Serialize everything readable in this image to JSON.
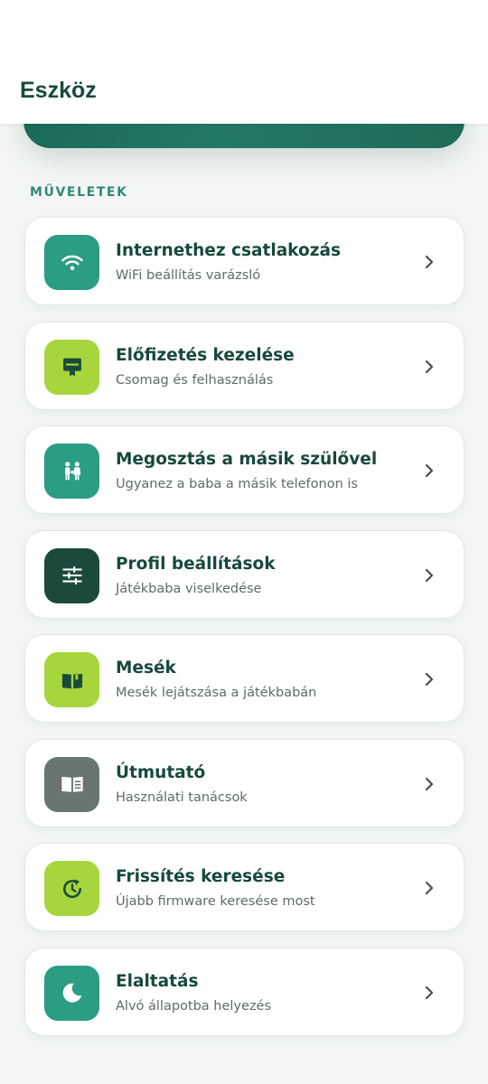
{
  "header": {
    "title": "Eszköz"
  },
  "section": {
    "label": "MŰVELETEK"
  },
  "items": [
    {
      "title": "Internethez csatlakozás",
      "subtitle": "WiFi beállítás varázsló",
      "icon": "wifi-icon",
      "color": "#2a9d84"
    },
    {
      "title": "Előfizetés kezelése",
      "subtitle": "Csomag és felhasználás",
      "icon": "subscription-icon",
      "color": "#a6d63c"
    },
    {
      "title": "Megosztás a másik szülővel",
      "subtitle": "Ugyanez a baba a másik telefonon is",
      "icon": "family-icon",
      "color": "#2a9d84"
    },
    {
      "title": "Profil beállítások",
      "subtitle": "Játékbaba viselkedése",
      "icon": "tune-icon",
      "color": "#1b4a3d"
    },
    {
      "title": "Mesék",
      "subtitle": "Mesék lejátszása a játékbabán",
      "icon": "book-icon",
      "color": "#a6d63c"
    },
    {
      "title": "Útmutató",
      "subtitle": "Használati tanácsok",
      "icon": "guide-icon",
      "color": "#687571"
    },
    {
      "title": "Frissítés keresése",
      "subtitle": "Újabb firmware keresése most",
      "icon": "update-icon",
      "color": "#a6d63c"
    },
    {
      "title": "Elaltatás",
      "subtitle": "Alvó állapotba helyezés",
      "icon": "moon-icon",
      "color": "#2a9d84"
    }
  ]
}
